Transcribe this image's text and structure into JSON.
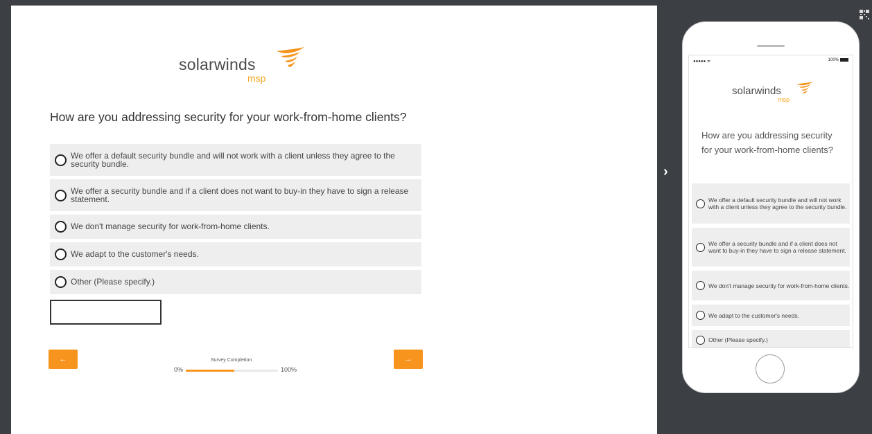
{
  "brand": {
    "name": "solarwinds",
    "sub": "msp",
    "accent": "#f7941d"
  },
  "survey": {
    "question": "How are you addressing security for your work-from-home clients?",
    "options": [
      "We offer a default security bundle and will not work with a client unless they agree to the security bundle.",
      "We offer a security bundle and if a client does not want to buy-in they have to sign a release statement.",
      "We don't manage security for work-from-home clients.",
      "We adapt to the customer's needs.",
      "Other (Please specify.)"
    ],
    "other_value": "",
    "prev_label": "←",
    "next_label": "→",
    "progress": {
      "label": "Survey Completion",
      "min_label": "0%",
      "max_label": "100%",
      "value_fraction": 0.53
    }
  },
  "mobile": {
    "status_left": "●●●●● ᯤ",
    "status_right": "100%",
    "question": "How are you addressing security for your work-from-home clients?",
    "options": [
      "We offer a default security bundle and will not work with a client unless they agree to the security bundle.",
      "We offer a security bundle and if a client does not want to buy-in they have to sign a release statement.",
      "We don't manage security for work-from-home clients.",
      "We adapt to the customer's needs.",
      "Other (Please specify.)"
    ]
  },
  "icons": {
    "toggle": "chevron-right-icon",
    "qr": "qr-code-icon"
  },
  "toggle_label": "›"
}
